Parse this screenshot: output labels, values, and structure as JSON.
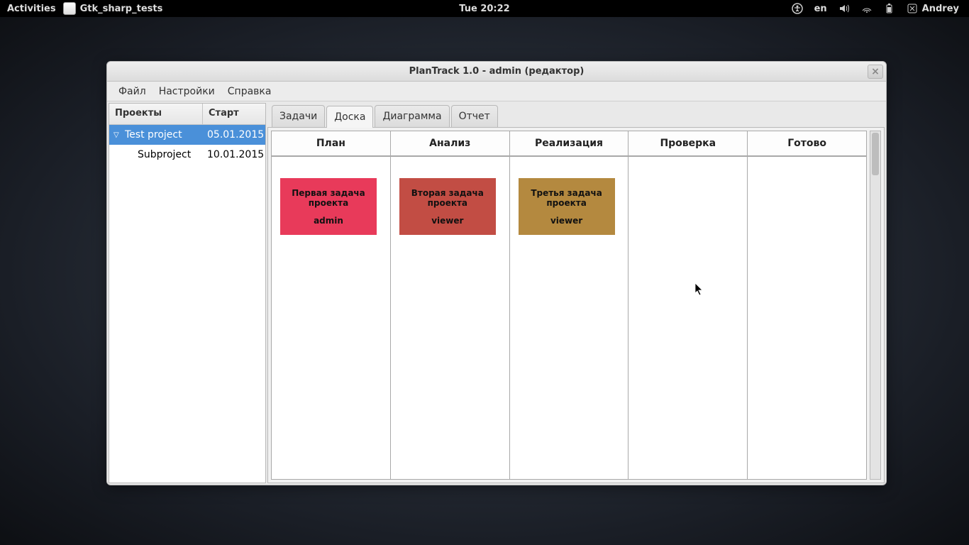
{
  "topbar": {
    "activities": "Activities",
    "app_task": "Gtk_sharp_tests",
    "clock": "Tue 20:22",
    "lang": "en",
    "user": "Andrey"
  },
  "window": {
    "title": "PlanTrack 1.0 - admin (редактор)"
  },
  "menubar": {
    "file": "Файл",
    "settings": "Настройки",
    "help": "Справка"
  },
  "sidebar": {
    "header_projects": "Проекты",
    "header_start": "Старт",
    "rows": [
      {
        "name": "Test project",
        "date": "05.01.2015"
      },
      {
        "name": "Subproject",
        "date": "10.01.2015"
      }
    ]
  },
  "tabs": {
    "tasks": "Задачи",
    "board": "Доска",
    "diagram": "Диаграмма",
    "report": "Отчет"
  },
  "board": {
    "columns": {
      "plan": "План",
      "analysis": "Анализ",
      "impl": "Реализация",
      "check": "Проверка",
      "done": "Готово"
    },
    "cards": {
      "plan": {
        "title": "Первая задача проекта",
        "assignee": "admin"
      },
      "analysis": {
        "title": "Вторая задача проекта",
        "assignee": "viewer"
      },
      "impl": {
        "title": "Третья задача проекта",
        "assignee": "viewer"
      }
    }
  }
}
